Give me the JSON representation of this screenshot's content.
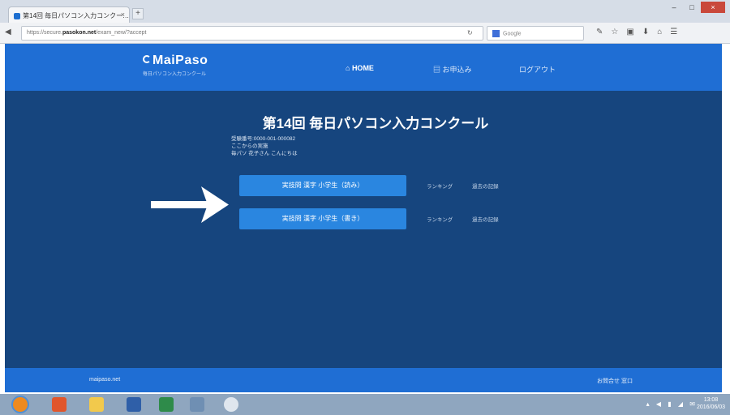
{
  "browser": {
    "tab_title": "第14回 毎日パソコン入力コンクー…",
    "tab_close": "×",
    "new_tab": "+",
    "url_prefix": "https://secure.",
    "url_domain": "pasokon.net",
    "url_path": "/exam_new/?accept",
    "search_placeholder": "Google",
    "window_buttons": [
      "–",
      "□",
      "×"
    ]
  },
  "header": {
    "logo_title": "MaiPaso",
    "logo_subtitle": "毎日パソコン入力コンクール",
    "nav": {
      "home": "HOME",
      "apply": "お申込み",
      "logout": "ログアウト"
    },
    "color_bg": "#1f6ed4"
  },
  "main": {
    "title": "第14回 毎日パソコン入力コンクール",
    "user_info": [
      "受験番号:0000-001-000082",
      "ここからの実施",
      "毎パソ 花子さん こんにちは"
    ],
    "exams": [
      {
        "label": "実技問 漢字 小学生（読み）",
        "ranking": "ランキング",
        "record": "過去の記録"
      },
      {
        "label": "実技問 漢字 小学生（書き）",
        "ranking": "ランキング",
        "record": "過去の記録"
      }
    ],
    "color_bg": "#16457e",
    "color_button": "#2a86e0"
  },
  "footer": {
    "site": "maipaso.net",
    "contact": "お問合せ 窓口"
  },
  "taskbar": {
    "clock_time": "13:08",
    "clock_date": "2016/06/03"
  }
}
